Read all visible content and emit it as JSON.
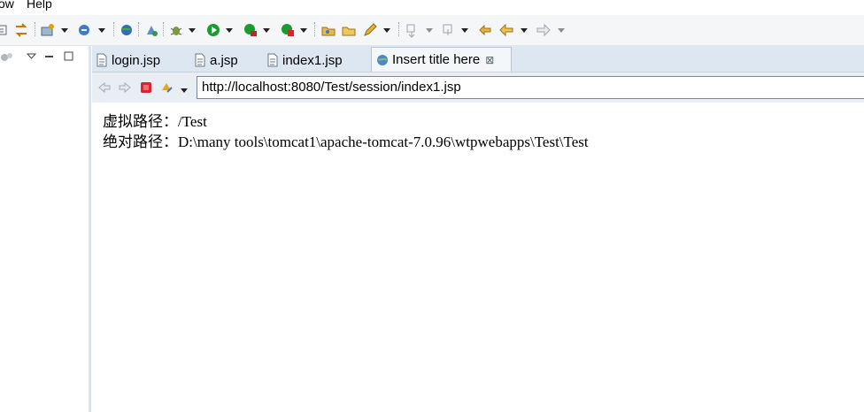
{
  "menu": {
    "items": [
      "ow",
      "Help"
    ]
  },
  "toolbar": {
    "icons": [
      "debug-perspective-icon",
      "switch-icon",
      "new-server-icon",
      "dropdown-arrow-icon",
      "spring-icon",
      "globe-icon",
      "run-external-icon",
      "bug-icon",
      "run-icon",
      "coverage-icon",
      "stop-server-icon",
      "open-folder-icon",
      "open-file-icon",
      "pencil-icon",
      "annotation-icon",
      "next-annotation-icon",
      "back-icon",
      "forward-icon"
    ]
  },
  "left_panel": {
    "icons": [
      "view-menu-icon",
      "minimize-icon",
      "maximize-icon"
    ]
  },
  "tabs": [
    {
      "label": "login.jsp",
      "active": false
    },
    {
      "label": "a.jsp",
      "active": false
    },
    {
      "label": "index1.jsp",
      "active": false
    },
    {
      "label": "Insert title here",
      "active": true,
      "close": "⊠"
    }
  ],
  "browser": {
    "url": "http://localhost:8080/Test/session/index1.jsp"
  },
  "content": {
    "line1_label": "虚拟路径：",
    "line1_value": "/Test",
    "line2_label": "绝对路径：",
    "line2_value": "D:\\many tools\\tomcat1\\apache-tomcat-7.0.96\\wtpwebapps\\Test\\Test"
  },
  "colors": {
    "tabstrip": "#dde7f1",
    "accent_green": "#1a9b2f",
    "stop_red": "#d9232e"
  }
}
